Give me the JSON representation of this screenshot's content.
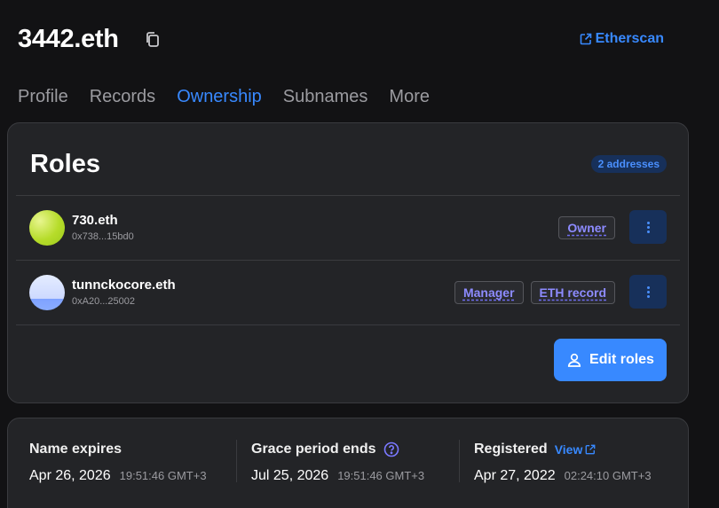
{
  "header": {
    "title": "3442.eth",
    "etherscan_label": "Etherscan"
  },
  "tabs": [
    {
      "label": "Profile",
      "active": false
    },
    {
      "label": "Records",
      "active": false
    },
    {
      "label": "Ownership",
      "active": true
    },
    {
      "label": "Subnames",
      "active": false
    },
    {
      "label": "More",
      "active": false
    }
  ],
  "roles": {
    "title": "Roles",
    "badge": "2 addresses",
    "rows": [
      {
        "name": "730.eth",
        "address": "0x738...15bd0",
        "tags": [
          "Owner"
        ]
      },
      {
        "name": "tunnckocore.eth",
        "address": "0xA20...25002",
        "tags": [
          "Manager",
          "ETH record"
        ]
      }
    ],
    "edit_label": "Edit roles"
  },
  "dates": {
    "expires": {
      "label": "Name expires",
      "date": "Apr 26, 2026",
      "time": "19:51:46 GMT+3"
    },
    "grace": {
      "label": "Grace period ends",
      "date": "Jul 25, 2026",
      "time": "19:51:46 GMT+3"
    },
    "registered": {
      "label": "Registered",
      "link": "View",
      "date": "Apr 27, 2022",
      "time": "02:24:10 GMT+3"
    }
  },
  "colors": {
    "accent": "#3889ff",
    "tag_text": "#8d8bff",
    "card_bg": "#232427",
    "page_bg": "#121214"
  },
  "icons": {
    "copy": "copy-icon",
    "external": "external-link-icon",
    "more": "more-vertical-icon",
    "user": "user-icon",
    "help": "help-circle-icon"
  }
}
